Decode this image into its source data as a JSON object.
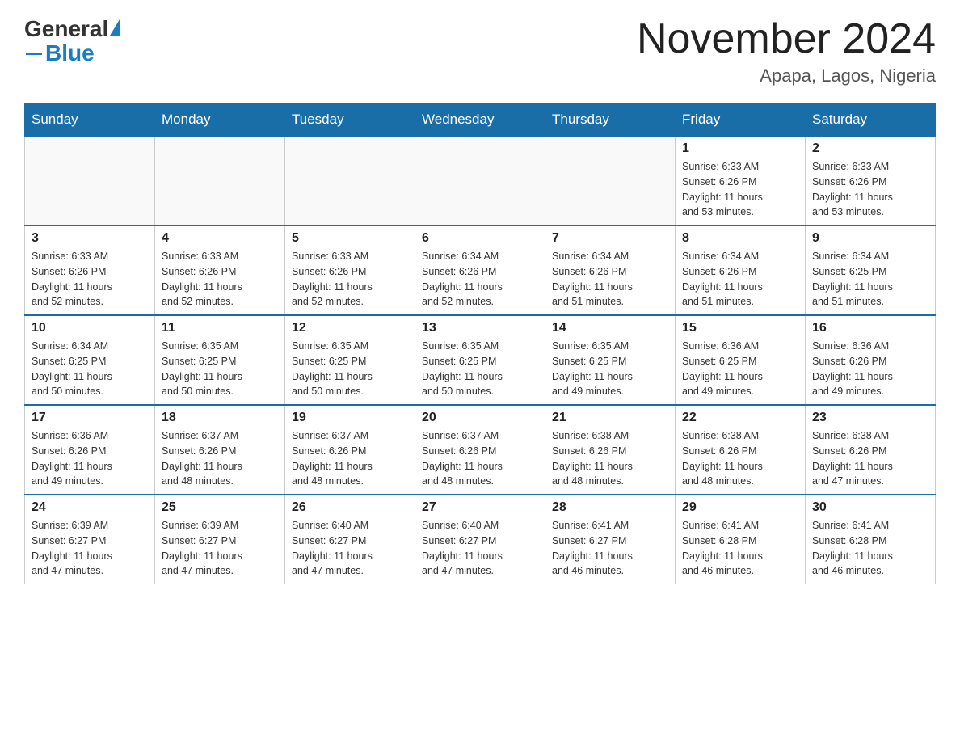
{
  "logo": {
    "general": "General",
    "blue": "Blue"
  },
  "title": "November 2024",
  "location": "Apapa, Lagos, Nigeria",
  "days_of_week": [
    "Sunday",
    "Monday",
    "Tuesday",
    "Wednesday",
    "Thursday",
    "Friday",
    "Saturday"
  ],
  "weeks": [
    [
      {
        "day": "",
        "info": ""
      },
      {
        "day": "",
        "info": ""
      },
      {
        "day": "",
        "info": ""
      },
      {
        "day": "",
        "info": ""
      },
      {
        "day": "",
        "info": ""
      },
      {
        "day": "1",
        "info": "Sunrise: 6:33 AM\nSunset: 6:26 PM\nDaylight: 11 hours\nand 53 minutes."
      },
      {
        "day": "2",
        "info": "Sunrise: 6:33 AM\nSunset: 6:26 PM\nDaylight: 11 hours\nand 53 minutes."
      }
    ],
    [
      {
        "day": "3",
        "info": "Sunrise: 6:33 AM\nSunset: 6:26 PM\nDaylight: 11 hours\nand 52 minutes."
      },
      {
        "day": "4",
        "info": "Sunrise: 6:33 AM\nSunset: 6:26 PM\nDaylight: 11 hours\nand 52 minutes."
      },
      {
        "day": "5",
        "info": "Sunrise: 6:33 AM\nSunset: 6:26 PM\nDaylight: 11 hours\nand 52 minutes."
      },
      {
        "day": "6",
        "info": "Sunrise: 6:34 AM\nSunset: 6:26 PM\nDaylight: 11 hours\nand 52 minutes."
      },
      {
        "day": "7",
        "info": "Sunrise: 6:34 AM\nSunset: 6:26 PM\nDaylight: 11 hours\nand 51 minutes."
      },
      {
        "day": "8",
        "info": "Sunrise: 6:34 AM\nSunset: 6:26 PM\nDaylight: 11 hours\nand 51 minutes."
      },
      {
        "day": "9",
        "info": "Sunrise: 6:34 AM\nSunset: 6:25 PM\nDaylight: 11 hours\nand 51 minutes."
      }
    ],
    [
      {
        "day": "10",
        "info": "Sunrise: 6:34 AM\nSunset: 6:25 PM\nDaylight: 11 hours\nand 50 minutes."
      },
      {
        "day": "11",
        "info": "Sunrise: 6:35 AM\nSunset: 6:25 PM\nDaylight: 11 hours\nand 50 minutes."
      },
      {
        "day": "12",
        "info": "Sunrise: 6:35 AM\nSunset: 6:25 PM\nDaylight: 11 hours\nand 50 minutes."
      },
      {
        "day": "13",
        "info": "Sunrise: 6:35 AM\nSunset: 6:25 PM\nDaylight: 11 hours\nand 50 minutes."
      },
      {
        "day": "14",
        "info": "Sunrise: 6:35 AM\nSunset: 6:25 PM\nDaylight: 11 hours\nand 49 minutes."
      },
      {
        "day": "15",
        "info": "Sunrise: 6:36 AM\nSunset: 6:25 PM\nDaylight: 11 hours\nand 49 minutes."
      },
      {
        "day": "16",
        "info": "Sunrise: 6:36 AM\nSunset: 6:26 PM\nDaylight: 11 hours\nand 49 minutes."
      }
    ],
    [
      {
        "day": "17",
        "info": "Sunrise: 6:36 AM\nSunset: 6:26 PM\nDaylight: 11 hours\nand 49 minutes."
      },
      {
        "day": "18",
        "info": "Sunrise: 6:37 AM\nSunset: 6:26 PM\nDaylight: 11 hours\nand 48 minutes."
      },
      {
        "day": "19",
        "info": "Sunrise: 6:37 AM\nSunset: 6:26 PM\nDaylight: 11 hours\nand 48 minutes."
      },
      {
        "day": "20",
        "info": "Sunrise: 6:37 AM\nSunset: 6:26 PM\nDaylight: 11 hours\nand 48 minutes."
      },
      {
        "day": "21",
        "info": "Sunrise: 6:38 AM\nSunset: 6:26 PM\nDaylight: 11 hours\nand 48 minutes."
      },
      {
        "day": "22",
        "info": "Sunrise: 6:38 AM\nSunset: 6:26 PM\nDaylight: 11 hours\nand 48 minutes."
      },
      {
        "day": "23",
        "info": "Sunrise: 6:38 AM\nSunset: 6:26 PM\nDaylight: 11 hours\nand 47 minutes."
      }
    ],
    [
      {
        "day": "24",
        "info": "Sunrise: 6:39 AM\nSunset: 6:27 PM\nDaylight: 11 hours\nand 47 minutes."
      },
      {
        "day": "25",
        "info": "Sunrise: 6:39 AM\nSunset: 6:27 PM\nDaylight: 11 hours\nand 47 minutes."
      },
      {
        "day": "26",
        "info": "Sunrise: 6:40 AM\nSunset: 6:27 PM\nDaylight: 11 hours\nand 47 minutes."
      },
      {
        "day": "27",
        "info": "Sunrise: 6:40 AM\nSunset: 6:27 PM\nDaylight: 11 hours\nand 47 minutes."
      },
      {
        "day": "28",
        "info": "Sunrise: 6:41 AM\nSunset: 6:27 PM\nDaylight: 11 hours\nand 46 minutes."
      },
      {
        "day": "29",
        "info": "Sunrise: 6:41 AM\nSunset: 6:28 PM\nDaylight: 11 hours\nand 46 minutes."
      },
      {
        "day": "30",
        "info": "Sunrise: 6:41 AM\nSunset: 6:28 PM\nDaylight: 11 hours\nand 46 minutes."
      }
    ]
  ]
}
